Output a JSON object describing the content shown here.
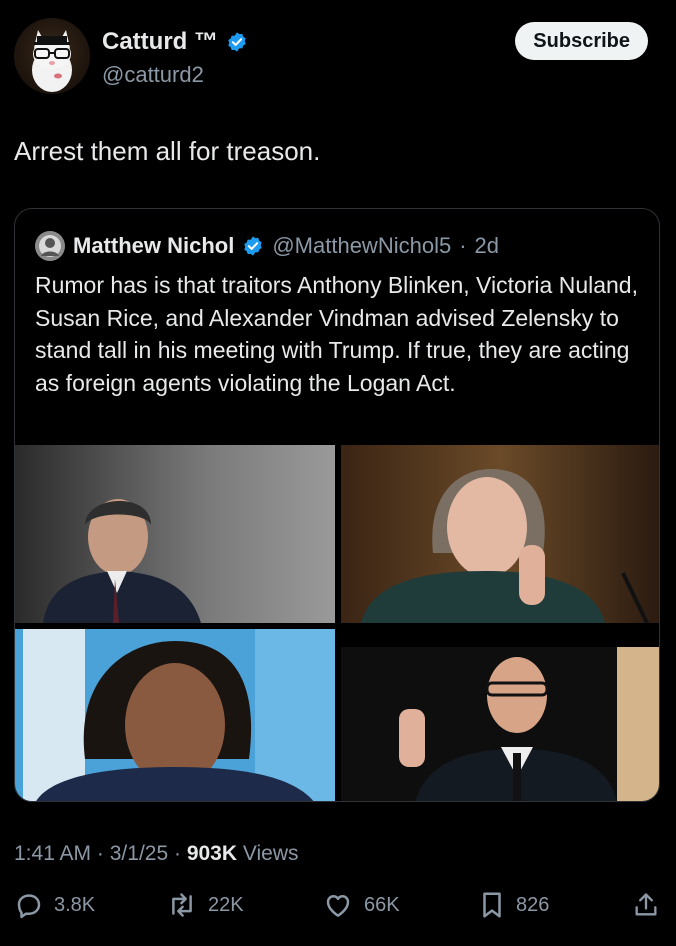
{
  "header": {
    "display_name": "Catturd ™",
    "handle": "@catturd2",
    "subscribe_label": "Subscribe"
  },
  "tweet": {
    "text": "Arrest them all for treason."
  },
  "quoted": {
    "name": "Matthew Nichol",
    "handle": "@MatthewNichol5",
    "sep": "·",
    "age": "2d",
    "text": "Rumor has is that traitors Anthony Blinken, Victoria Nuland, Susan Rice, and Alexander Vindman advised Zelensky to stand tall in his meeting with Trump. If true, they are acting as foreign agents violating the Logan Act."
  },
  "meta": {
    "time": "1:41 AM",
    "date": "3/1/25",
    "sep": "·",
    "views_count": "903K",
    "views_label": "Views"
  },
  "actions": {
    "replies": "3.8K",
    "reposts": "22K",
    "likes": "66K",
    "bookmarks": "826"
  },
  "colors": {
    "background": "#000000",
    "verified": "#1d9bf0",
    "muted": "#8b98a5"
  },
  "icons": [
    "verified-badge-icon",
    "reply-icon",
    "repost-icon",
    "like-icon",
    "bookmark-icon",
    "share-icon"
  ]
}
